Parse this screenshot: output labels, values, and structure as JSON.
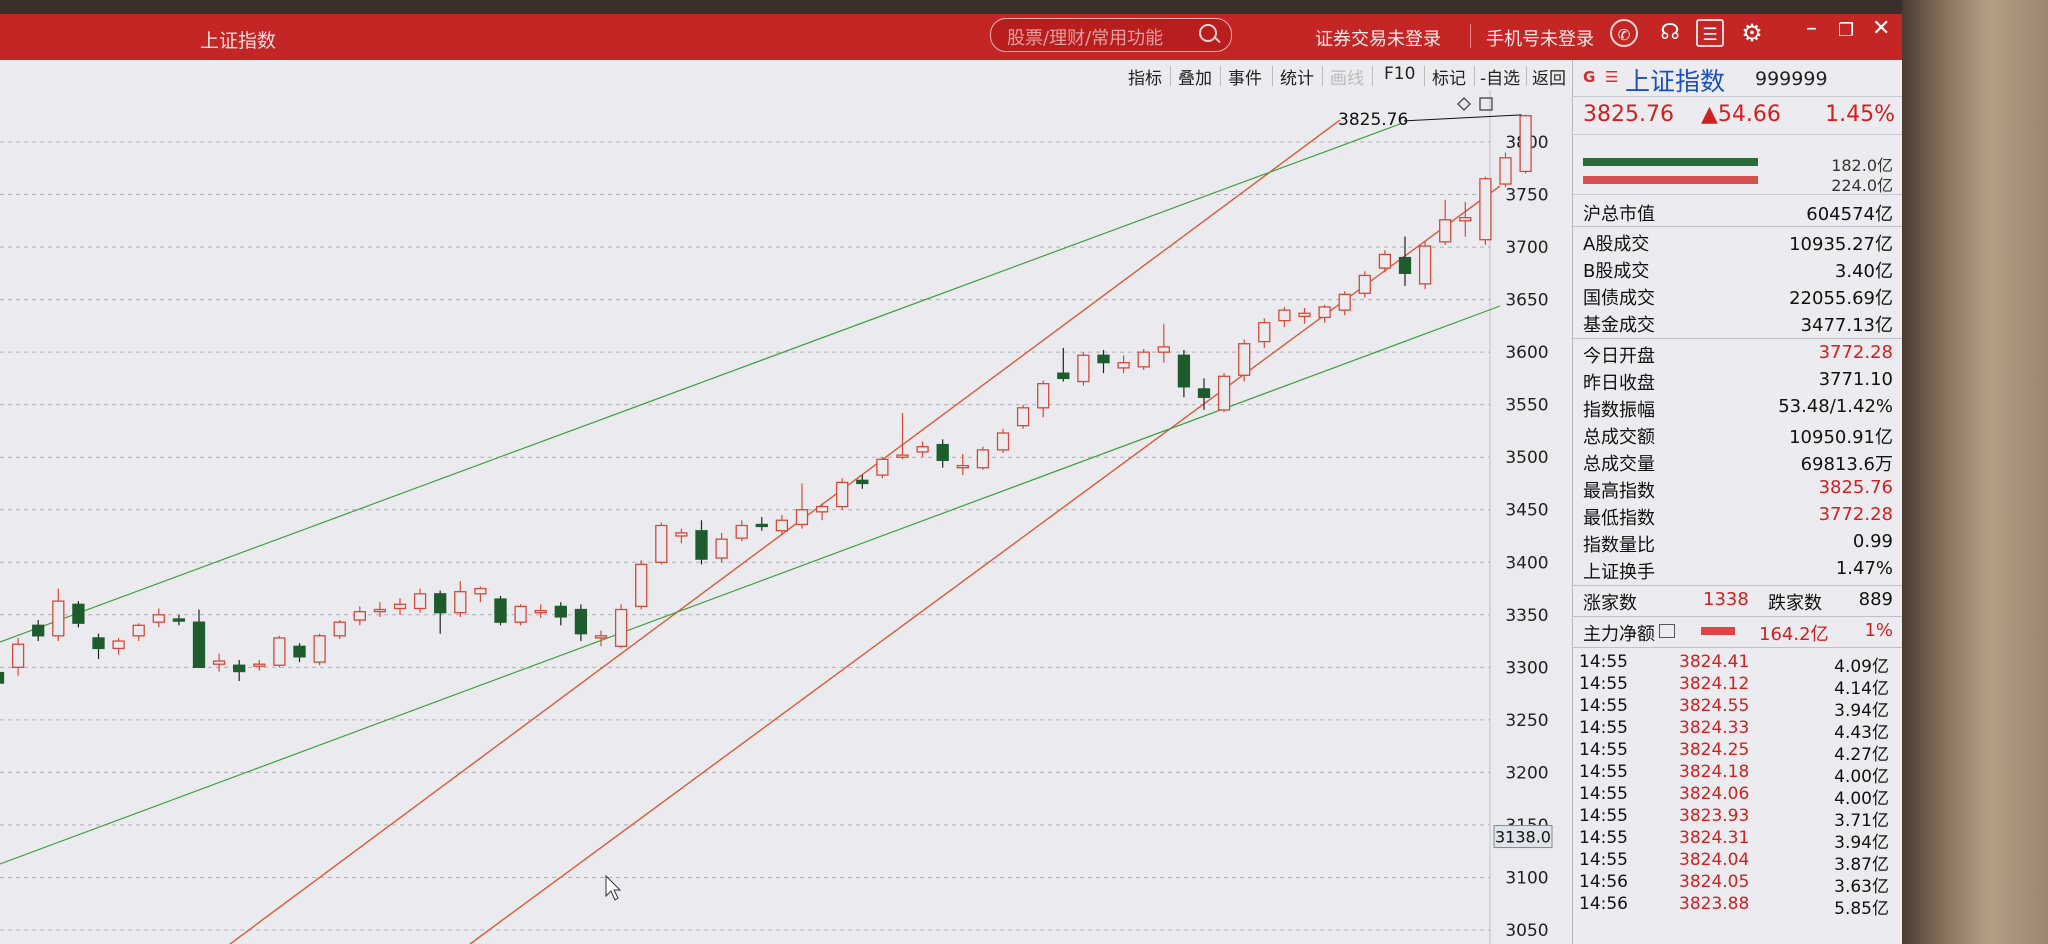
{
  "app": {
    "title": "上证指数",
    "search_placeholder": "股票/理财/常用功能",
    "login_text": "证券交易未登录",
    "phone_login": "手机号未登录"
  },
  "toolbar": {
    "items": [
      "指标",
      "叠加",
      "事件",
      "统计",
      "画线",
      "F10",
      "标记",
      "-自选",
      "返回"
    ]
  },
  "chart": {
    "y_ticks": [
      "3800",
      "3750",
      "3700",
      "3650",
      "3600",
      "3550",
      "3500",
      "3450",
      "3400",
      "3350",
      "3300",
      "3250",
      "3200",
      "3150",
      "3100",
      "3050"
    ],
    "current_price_label": "3138.0",
    "high_annotation": "3825.76",
    "colors": {
      "up": "#d24a3a",
      "down": "#1e5c2e",
      "channel_red": "#d85a38",
      "channel_green": "#3da03d"
    }
  },
  "chart_data": {
    "type": "candlestick",
    "ylim": [
      3030,
      3840
    ],
    "candles": [
      {
        "o": 3295,
        "h": 3305,
        "l": 3280,
        "c": 3285
      },
      {
        "o": 3300,
        "h": 3328,
        "l": 3292,
        "c": 3322
      },
      {
        "o": 3340,
        "h": 3345,
        "l": 3325,
        "c": 3330
      },
      {
        "o": 3330,
        "h": 3375,
        "l": 3325,
        "c": 3363
      },
      {
        "o": 3360,
        "h": 3363,
        "l": 3338,
        "c": 3342
      },
      {
        "o": 3328,
        "h": 3332,
        "l": 3308,
        "c": 3318
      },
      {
        "o": 3318,
        "h": 3328,
        "l": 3312,
        "c": 3325
      },
      {
        "o": 3330,
        "h": 3342,
        "l": 3325,
        "c": 3340
      },
      {
        "o": 3343,
        "h": 3356,
        "l": 3338,
        "c": 3350
      },
      {
        "o": 3346,
        "h": 3350,
        "l": 3340,
        "c": 3344
      },
      {
        "o": 3343,
        "h": 3355,
        "l": 3300,
        "c": 3300
      },
      {
        "o": 3303,
        "h": 3313,
        "l": 3296,
        "c": 3306
      },
      {
        "o": 3302,
        "h": 3307,
        "l": 3287,
        "c": 3296
      },
      {
        "o": 3302,
        "h": 3307,
        "l": 3297,
        "c": 3303
      },
      {
        "o": 3302,
        "h": 3330,
        "l": 3300,
        "c": 3328
      },
      {
        "o": 3320,
        "h": 3323,
        "l": 3305,
        "c": 3310
      },
      {
        "o": 3305,
        "h": 3332,
        "l": 3302,
        "c": 3330
      },
      {
        "o": 3330,
        "h": 3345,
        "l": 3327,
        "c": 3343
      },
      {
        "o": 3345,
        "h": 3358,
        "l": 3340,
        "c": 3353
      },
      {
        "o": 3353,
        "h": 3362,
        "l": 3348,
        "c": 3355
      },
      {
        "o": 3356,
        "h": 3366,
        "l": 3350,
        "c": 3360
      },
      {
        "o": 3356,
        "h": 3375,
        "l": 3352,
        "c": 3370
      },
      {
        "o": 3370,
        "h": 3373,
        "l": 3332,
        "c": 3352
      },
      {
        "o": 3352,
        "h": 3382,
        "l": 3348,
        "c": 3372
      },
      {
        "o": 3370,
        "h": 3377,
        "l": 3362,
        "c": 3375
      },
      {
        "o": 3365,
        "h": 3368,
        "l": 3340,
        "c": 3343
      },
      {
        "o": 3343,
        "h": 3360,
        "l": 3340,
        "c": 3358
      },
      {
        "o": 3352,
        "h": 3360,
        "l": 3347,
        "c": 3354
      },
      {
        "o": 3358,
        "h": 3362,
        "l": 3340,
        "c": 3348
      },
      {
        "o": 3355,
        "h": 3360,
        "l": 3325,
        "c": 3332
      },
      {
        "o": 3328,
        "h": 3335,
        "l": 3320,
        "c": 3330
      },
      {
        "o": 3320,
        "h": 3360,
        "l": 3318,
        "c": 3355
      },
      {
        "o": 3358,
        "h": 3402,
        "l": 3355,
        "c": 3398
      },
      {
        "o": 3400,
        "h": 3438,
        "l": 3398,
        "c": 3435
      },
      {
        "o": 3425,
        "h": 3432,
        "l": 3418,
        "c": 3428
      },
      {
        "o": 3430,
        "h": 3440,
        "l": 3398,
        "c": 3403
      },
      {
        "o": 3404,
        "h": 3428,
        "l": 3400,
        "c": 3422
      },
      {
        "o": 3423,
        "h": 3440,
        "l": 3420,
        "c": 3435
      },
      {
        "o": 3436,
        "h": 3443,
        "l": 3430,
        "c": 3435
      },
      {
        "o": 3430,
        "h": 3445,
        "l": 3426,
        "c": 3440
      },
      {
        "o": 3436,
        "h": 3475,
        "l": 3432,
        "c": 3450
      },
      {
        "o": 3448,
        "h": 3456,
        "l": 3440,
        "c": 3453
      },
      {
        "o": 3453,
        "h": 3480,
        "l": 3450,
        "c": 3476
      },
      {
        "o": 3478,
        "h": 3483,
        "l": 3470,
        "c": 3475
      },
      {
        "o": 3483,
        "h": 3500,
        "l": 3480,
        "c": 3498
      },
      {
        "o": 3500,
        "h": 3542,
        "l": 3498,
        "c": 3502
      },
      {
        "o": 3505,
        "h": 3515,
        "l": 3500,
        "c": 3510
      },
      {
        "o": 3512,
        "h": 3517,
        "l": 3490,
        "c": 3497
      },
      {
        "o": 3490,
        "h": 3503,
        "l": 3483,
        "c": 3492
      },
      {
        "o": 3490,
        "h": 3510,
        "l": 3488,
        "c": 3507
      },
      {
        "o": 3507,
        "h": 3527,
        "l": 3504,
        "c": 3523
      },
      {
        "o": 3530,
        "h": 3550,
        "l": 3527,
        "c": 3547
      },
      {
        "o": 3547,
        "h": 3573,
        "l": 3538,
        "c": 3570
      },
      {
        "o": 3580,
        "h": 3604,
        "l": 3572,
        "c": 3575
      },
      {
        "o": 3572,
        "h": 3600,
        "l": 3568,
        "c": 3597
      },
      {
        "o": 3597,
        "h": 3602,
        "l": 3580,
        "c": 3590
      },
      {
        "o": 3585,
        "h": 3597,
        "l": 3580,
        "c": 3590
      },
      {
        "o": 3586,
        "h": 3603,
        "l": 3583,
        "c": 3600
      },
      {
        "o": 3600,
        "h": 3627,
        "l": 3590,
        "c": 3605
      },
      {
        "o": 3597,
        "h": 3602,
        "l": 3557,
        "c": 3567
      },
      {
        "o": 3565,
        "h": 3575,
        "l": 3545,
        "c": 3557
      },
      {
        "o": 3545,
        "h": 3580,
        "l": 3543,
        "c": 3577
      },
      {
        "o": 3578,
        "h": 3612,
        "l": 3572,
        "c": 3608
      },
      {
        "o": 3610,
        "h": 3632,
        "l": 3604,
        "c": 3628
      },
      {
        "o": 3630,
        "h": 3643,
        "l": 3624,
        "c": 3640
      },
      {
        "o": 3634,
        "h": 3642,
        "l": 3627,
        "c": 3637
      },
      {
        "o": 3633,
        "h": 3645,
        "l": 3628,
        "c": 3643
      },
      {
        "o": 3640,
        "h": 3658,
        "l": 3635,
        "c": 3655
      },
      {
        "o": 3656,
        "h": 3677,
        "l": 3652,
        "c": 3673
      },
      {
        "o": 3680,
        "h": 3697,
        "l": 3676,
        "c": 3693
      },
      {
        "o": 3690,
        "h": 3710,
        "l": 3663,
        "c": 3675
      },
      {
        "o": 3665,
        "h": 3705,
        "l": 3660,
        "c": 3701
      },
      {
        "o": 3705,
        "h": 3745,
        "l": 3702,
        "c": 3726
      },
      {
        "o": 3725,
        "h": 3743,
        "l": 3710,
        "c": 3728
      },
      {
        "o": 3707,
        "h": 3767,
        "l": 3702,
        "c": 3765
      },
      {
        "o": 3760,
        "h": 3790,
        "l": 3757,
        "c": 3785
      },
      {
        "o": 3772,
        "h": 3826,
        "l": 3770,
        "c": 3825
      }
    ]
  },
  "quote": {
    "name": "上证指数",
    "code": "999999",
    "price": "3825.76",
    "change": "▲54.66",
    "pct": "1.45%",
    "bar_green_val": "182.0亿",
    "bar_red_val": "224.0亿",
    "market_value_label": "沪总市值",
    "market_value": "604574亿",
    "a_share_label": "A股成交",
    "a_share": "10935.27亿",
    "b_share_label": "B股成交",
    "b_share": "3.40亿",
    "bond_label": "国债成交",
    "bond": "22055.69亿",
    "fund_label": "基金成交",
    "fund": "3477.13亿",
    "open_label": "今日开盘",
    "open": "3772.28",
    "prev_close_label": "昨日收盘",
    "prev_close": "3771.10",
    "amplitude_label": "指数振幅",
    "amplitude": "53.48/1.42%",
    "turnover_label": "总成交额",
    "turnover": "10950.91亿",
    "volume_label": "总成交量",
    "volume": "69813.6万",
    "high_label": "最高指数",
    "high": "3825.76",
    "low_label": "最低指数",
    "low": "3772.28",
    "vol_ratio_label": "指数量比",
    "vol_ratio": "0.99",
    "turnover_rate_label": "上证换手",
    "turnover_rate": "1.47%",
    "up_label": "涨家数",
    "up_count": "1338",
    "down_label": "跌家数",
    "down_count": "889",
    "net_flow_label": "主力净额",
    "net_flow": "164.2亿",
    "net_flow_pct": "1%"
  },
  "ticks": [
    {
      "time": "14:55",
      "price": "3824.41",
      "vol": "4.09亿"
    },
    {
      "time": "14:55",
      "price": "3824.12",
      "vol": "4.14亿"
    },
    {
      "time": "14:55",
      "price": "3824.55",
      "vol": "3.94亿"
    },
    {
      "time": "14:55",
      "price": "3824.33",
      "vol": "4.43亿"
    },
    {
      "time": "14:55",
      "price": "3824.25",
      "vol": "4.27亿"
    },
    {
      "time": "14:55",
      "price": "3824.18",
      "vol": "4.00亿"
    },
    {
      "time": "14:55",
      "price": "3824.06",
      "vol": "4.00亿"
    },
    {
      "time": "14:55",
      "price": "3823.93",
      "vol": "3.71亿"
    },
    {
      "time": "14:55",
      "price": "3824.31",
      "vol": "3.94亿"
    },
    {
      "time": "14:55",
      "price": "3824.04",
      "vol": "3.87亿"
    },
    {
      "time": "14:56",
      "price": "3824.05",
      "vol": "3.63亿"
    },
    {
      "time": "14:56",
      "price": "3823.88",
      "vol": "5.85亿"
    }
  ]
}
